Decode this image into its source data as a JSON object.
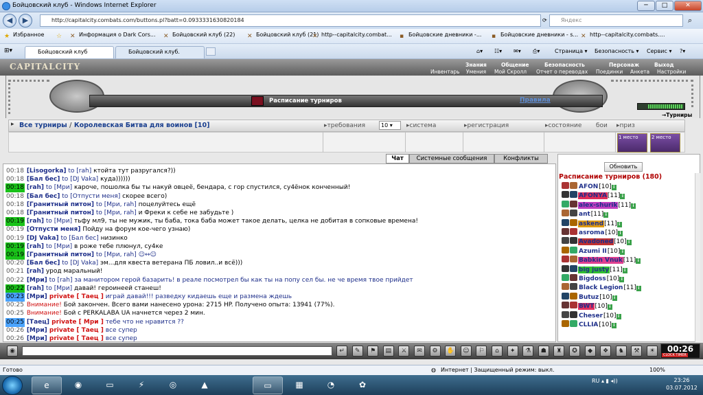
{
  "window": {
    "title": "Бойцовский клуб - Windows Internet Explorer",
    "url": "http://capitalcity.combats.com/buttons.pl?batt=0.0933331630820184",
    "search_placeholder": "Яндекс"
  },
  "favorites": {
    "favorites_label": "Избранное",
    "items": [
      "Информация о Dark Cors...",
      "Бойцовский клуб (22)",
      "Бойцовский клуб (21)",
      "http--capitalcity.combat...",
      "Бойцовские дневники -...",
      "Бойцовские дневники - s...",
      "http--capitalcity.combats...."
    ]
  },
  "tabs": [
    {
      "label": "Бойцовский клуб"
    },
    {
      "label": "Бойцовский клуб."
    }
  ],
  "toolbar": {
    "page": "Страница",
    "security": "Безопасность",
    "service": "Сервис"
  },
  "game": {
    "logo": "CAPITALCITY",
    "nav_top": [
      "Знания",
      "Общение",
      "Безопасность",
      "Персонаж",
      "Выход"
    ],
    "nav_bottom": [
      "Инвентарь",
      "Умения",
      "Мой Скролл",
      "Отчет о переводах",
      "Поединки",
      "Анкета",
      "Настройки"
    ],
    "schedule_title": "Расписание турниров",
    "rules_link": "Правила",
    "tournaments_label": "Турниры",
    "breadcrumb_all": "Все турниры",
    "breadcrumb_sep": "/",
    "breadcrumb_current": "Королевская Битва для воинов [10]",
    "columns": {
      "requirements": "требования",
      "system": "система",
      "registration": "регистрация",
      "state": "состояние",
      "fights": "бои",
      "prize": "приз"
    },
    "requirements_value": "10",
    "prize_places": [
      "1 место",
      "2 место"
    ],
    "tournament_fill": 0.75
  },
  "chat_tabs": {
    "chat": "Чат",
    "system": "Системные сообщения",
    "conflicts": "Конфликты"
  },
  "chat": [
    {
      "time": "00:18",
      "hl": "",
      "a": "[Lisogorka]",
      "mid": " to ",
      "b": "[rah]",
      "text": " ктойта тут разругался?))"
    },
    {
      "time": "00:18",
      "hl": "",
      "a": "[Бал бес]",
      "mid": " to ",
      "b": "[DJ Vaka]",
      "text": " куда))))))"
    },
    {
      "time": "00:18",
      "hl": "g",
      "a": "[rah]",
      "mid": " to ",
      "b": "[Мри]",
      "text": " кароче, пошолка бы ты накуй овцеё, бендара, с гор спустился, су4ёнок конченный!"
    },
    {
      "time": "00:18",
      "hl": "",
      "a": "[Бал бес]",
      "mid": " to ",
      "b": "[Отпусти меня]",
      "text": " скорее всего)"
    },
    {
      "time": "00:18",
      "hl": "",
      "a": "[Гранитный питон]",
      "mid": " to ",
      "b": "[Мри, rah]",
      "text": " поцелуйтесь ещё"
    },
    {
      "time": "00:18",
      "hl": "",
      "a": "[Гранитный питон]",
      "mid": " to ",
      "b": "[Мри, rah]",
      "text": " и Фреки к себе не забудьте )"
    },
    {
      "time": "00:19",
      "hl": "g",
      "a": "[rah]",
      "mid": " to ",
      "b": "[Мри]",
      "text": " тьфу мл9, ты не мужик, ты баба, тока баба может такое делать, целка не добитая в сопковые времена!"
    },
    {
      "time": "00:19",
      "hl": "",
      "a": "[Отпусти меня]",
      "mid": "",
      "b": "",
      "text": " Пойду на форум кое-чего узнаю)"
    },
    {
      "time": "00:19",
      "hl": "",
      "a": "[DJ Vaka]",
      "mid": " to ",
      "b": "[Бал бес]",
      "text": " низинко"
    },
    {
      "time": "00:19",
      "hl": "g",
      "a": "[rah]",
      "mid": " to ",
      "b": "[Мри]",
      "text": " в роже тебе плюнул, су4ке"
    },
    {
      "time": "00:19",
      "hl": "g",
      "a": "[Гранитный питон]",
      "mid": " to ",
      "b": "[Мри, rah]",
      "text": " ☺↔☺"
    },
    {
      "time": "00:20",
      "hl": "",
      "a": "[Бал бес]",
      "mid": " to ",
      "b": "[DJ Vaka]",
      "text": " эм...для квеста ветерана ПБ ловил..и всё)))"
    },
    {
      "time": "00:21",
      "hl": "",
      "a": "[rah]",
      "mid": "",
      "b": "",
      "text": " урод маральный!"
    },
    {
      "time": "00:22",
      "hl": "",
      "a": "[Мри]",
      "mid": " to ",
      "b": "[rah]",
      "text": " за манитором герой базарить! в реале посмотрел бы как ты на попу сел бы. не че время твое прийдет"
    },
    {
      "time": "00:22",
      "hl": "g",
      "a": "[rah]",
      "mid": " to ",
      "b": "[Мри]",
      "text": " давай! героинеей станеш!"
    },
    {
      "time": "00:23",
      "hl": "b",
      "a": "[Мри]",
      "mid": " private ",
      "b": "[ Таец ]",
      "text": " играй давай!!! разведку кидаешь еще и размена ждешь"
    },
    {
      "time": "00:25",
      "hl": "",
      "a": "Внимание!",
      "mid": "",
      "b": "",
      "text": " Бой закончен. Всего вами нанесено урона: 2715 HP. Получено опыта: 13941 (77%)."
    },
    {
      "time": "00:25",
      "hl": "",
      "a": "Внимание!",
      "mid": "",
      "b": "",
      "text": " Бой с PERKALABA UA начнется через 2 мин."
    },
    {
      "time": "00:25",
      "hl": "b",
      "a": "[Таец]",
      "mid": " private ",
      "b": "[ Мри ]",
      "text": " тебе что не нравится ??"
    },
    {
      "time": "00:26",
      "hl": "",
      "a": "[Мри]",
      "mid": " private ",
      "b": "[ Таец ]",
      "text": " все супер"
    },
    {
      "time": "00:26",
      "hl": "",
      "a": "[Мри]",
      "mid": " private ",
      "b": "[ Таец ]",
      "text": " все супер"
    }
  ],
  "sidebar": {
    "refresh": "Обновить",
    "schedule": "Расписание турниров (180)",
    "players": [
      {
        "name": "AFON",
        "level": "[10]",
        "bg": ""
      },
      {
        "name": "AFONYA",
        "level": "[11]",
        "bg": "#e0305a"
      },
      {
        "name": "alex-shurik",
        "level": "[11]",
        "bg": "#c040c0"
      },
      {
        "name": "ant",
        "level": "[11]",
        "bg": ""
      },
      {
        "name": "askend",
        "level": "[11]",
        "bg": "#e09a10"
      },
      {
        "name": "asroma",
        "level": "[10]",
        "bg": ""
      },
      {
        "name": "Avadoned",
        "level": "[10]",
        "bg": "#c03030"
      },
      {
        "name": "Azumi II",
        "level": "[10]",
        "bg": ""
      },
      {
        "name": "Babkin Vnuk",
        "level": "[11]",
        "bg": "#e04090"
      },
      {
        "name": "big justy",
        "level": "[11]",
        "bg": "#30c030"
      },
      {
        "name": "Bigdoss",
        "level": "[10]",
        "bg": ""
      },
      {
        "name": "Black Legion",
        "level": "[11]",
        "bg": ""
      },
      {
        "name": "Butuz",
        "level": "[10]",
        "bg": ""
      },
      {
        "name": "BWT",
        "level": "[10]",
        "bg": "#e03060"
      },
      {
        "name": "Cheser",
        "level": "[10]",
        "bg": ""
      },
      {
        "name": "CLLIA",
        "level": "[10]",
        "bg": ""
      }
    ]
  },
  "clock": {
    "time": "00:26",
    "label": "CLOCK TIMER"
  },
  "ie_status": {
    "left": "Готово",
    "zone": "Интернет | Защищенный режим: выкл.",
    "zoom": "100%"
  },
  "taskbar": {
    "lang": "RU",
    "time": "23:26",
    "date": "03.07.2012"
  }
}
